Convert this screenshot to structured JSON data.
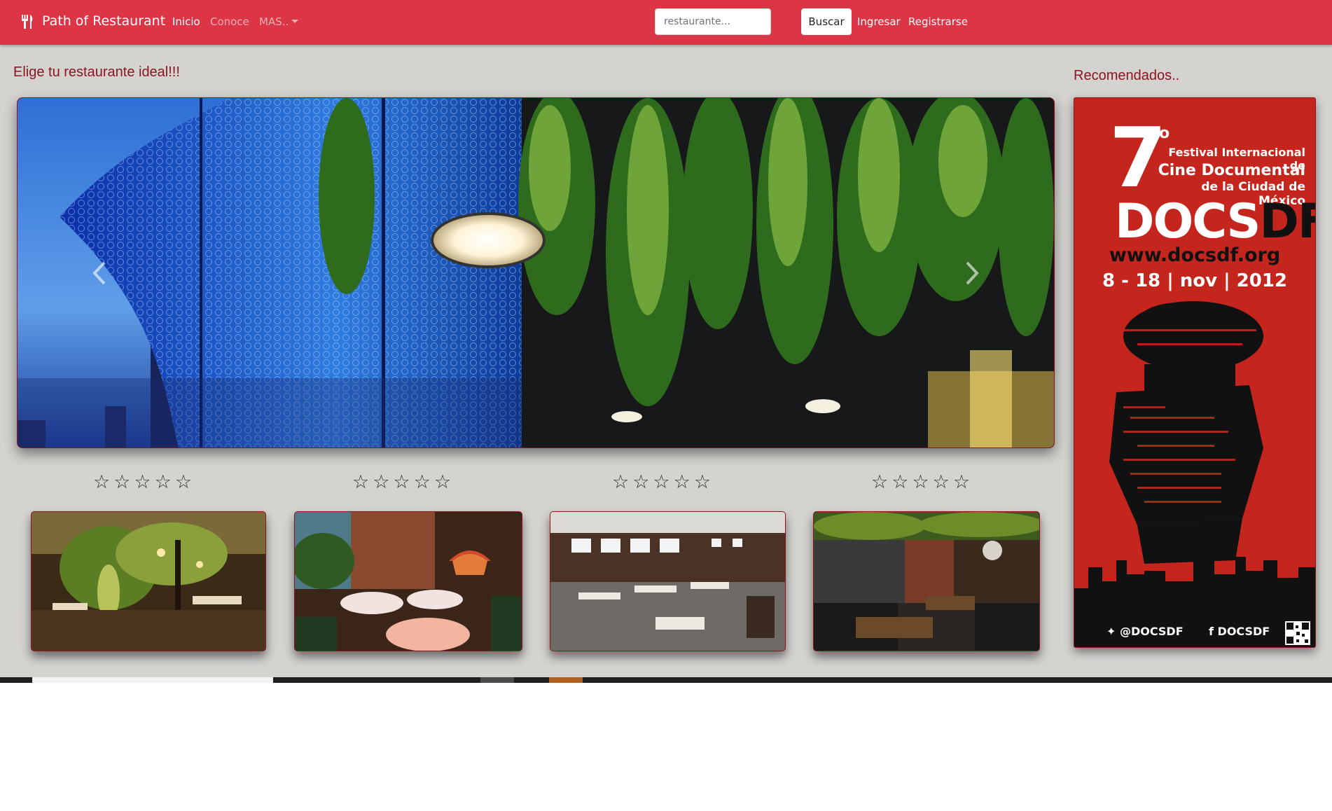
{
  "navbar": {
    "brand": "Path of Restaurant",
    "brand_icon": "utensils-icon",
    "links": {
      "inicio": "Inicio",
      "conoce": "Conoce",
      "mas": "MAS.."
    },
    "search": {
      "placeholder": "restaurante...",
      "value": ""
    },
    "search_button": "Buscar",
    "ingresar": "Ingresar",
    "registrarse": "Registrarse",
    "background_color": "#dc3545"
  },
  "main": {
    "heading": "Elige tu restaurante ideal!!!",
    "carousel": {
      "image": "restaurant-terrace-with-hanging-plants-photo",
      "prev_icon": "chevron-left-icon",
      "next_icon": "chevron-right-icon"
    },
    "restaurants": [
      {
        "stars": "☆☆☆☆☆",
        "image": "outdoor-patio-restaurant-photo"
      },
      {
        "stars": "☆☆☆☆☆",
        "image": "garden-dining-room-photo"
      },
      {
        "stars": "☆☆☆☆☆",
        "image": "modern-dining-room-photo"
      },
      {
        "stars": "☆☆☆☆☆",
        "image": "brick-wall-dining-room-photo"
      }
    ]
  },
  "sidebar": {
    "heading": "Recomendados..",
    "ad": {
      "number": "7",
      "number_suffix": "o",
      "line1": "Festival Internacional de",
      "line2": "Cine Documental",
      "line3": "de la Ciudad de México",
      "logo_a": "DOCS",
      "logo_b": "DF",
      "url": "www.docsdf.org",
      "dates": "8 - 18 | nov | 2012",
      "twitter": "@DOCSDF",
      "facebook": "DOCSDF",
      "background_color": "#c4261d"
    }
  },
  "colors": {
    "heading": "#8b1520",
    "page_background": "#d4d3d0"
  }
}
